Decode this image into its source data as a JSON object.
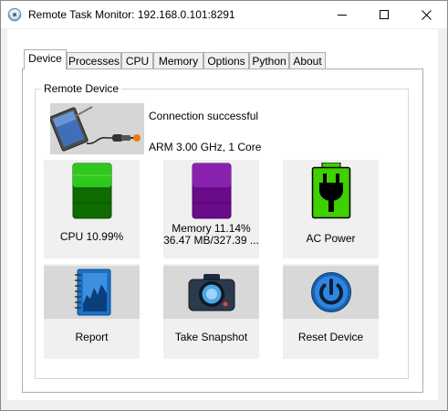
{
  "window": {
    "title": "Remote Task Monitor: 192.168.0.101:8291"
  },
  "tabs": [
    {
      "label": "Device",
      "active": true
    },
    {
      "label": "Processes",
      "active": false
    },
    {
      "label": "CPU",
      "active": false
    },
    {
      "label": "Memory",
      "active": false
    },
    {
      "label": "Options",
      "active": false
    },
    {
      "label": "Python",
      "active": false
    },
    {
      "label": "About",
      "active": false
    }
  ],
  "device": {
    "group_title": "Remote Device",
    "image_icon": "tablet-plugged-icon",
    "status": "Connection successful",
    "arch": "ARM 3.00 GHz, 1 Core"
  },
  "tiles": {
    "cpu": {
      "label": "CPU 10.99%",
      "icon": "cpu-bar-icon",
      "level": 0.1099,
      "color": "#0f6e00"
    },
    "memory": {
      "label1": "Memory 11.14%",
      "label2": "36.47 MB/327.39 ...",
      "icon": "memory-bar-icon",
      "level": 0.1114,
      "color": "#6a0b8a"
    },
    "power": {
      "label": "AC Power",
      "icon": "power-plug-icon",
      "color": "#3fd000"
    },
    "report": {
      "label": "Report",
      "icon": "notebook-chart-icon"
    },
    "snapshot": {
      "label": "Take Snapshot",
      "icon": "camera-icon"
    },
    "reset": {
      "label": "Reset Device",
      "icon": "power-button-icon"
    }
  }
}
